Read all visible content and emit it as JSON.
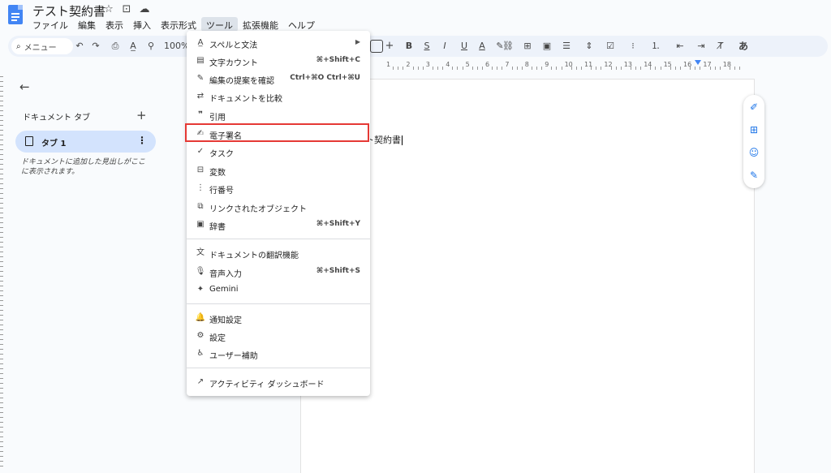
{
  "header": {
    "title": "テスト契約書",
    "menus": [
      "ファイル",
      "編集",
      "表示",
      "挿入",
      "表示形式",
      "ツール",
      "拡張機能",
      "ヘルプ"
    ],
    "active_menu": "ツール"
  },
  "toolbar": {
    "search_label": "メニュー",
    "zoom": "100%",
    "bold": "B",
    "italic": "I",
    "underline": "U",
    "text_color": "A",
    "input_tools": "あ"
  },
  "ruler": {
    "numbers": [
      "1",
      "2",
      "3",
      "4",
      "5",
      "6",
      "7",
      "8",
      "9",
      "10",
      "11",
      "12",
      "13",
      "14",
      "15",
      "16",
      "17",
      "18"
    ]
  },
  "sidebar": {
    "tabs_title": "ドキュメント タブ",
    "tab_label": "タブ 1",
    "hint": "ドキュメントに追加した見出しがここに表示されます。"
  },
  "document": {
    "text": "ト契約書"
  },
  "tools_menu": {
    "items": [
      {
        "label": "スペルと文法",
        "shortcut": "",
        "icon": "spellcheck-icon",
        "submenu": true
      },
      {
        "label": "文字カウント",
        "shortcut": "⌘+Shift+C",
        "icon": "word-count-icon"
      },
      {
        "label": "編集の提案を確認",
        "shortcut": "Ctrl+⌘O Ctrl+⌘U",
        "icon": "review-edits-icon"
      },
      {
        "label": "ドキュメントを比較",
        "shortcut": "",
        "icon": "compare-icon"
      },
      {
        "label": "引用",
        "shortcut": "",
        "icon": "quote-icon"
      },
      {
        "label": "電子署名",
        "shortcut": "",
        "icon": "signature-icon"
      },
      {
        "label": "タスク",
        "shortcut": "",
        "icon": "task-icon"
      },
      {
        "label": "変数",
        "shortcut": "",
        "icon": "variable-icon"
      },
      {
        "label": "行番号",
        "shortcut": "",
        "icon": "line-numbers-icon"
      },
      {
        "label": "リンクされたオブジェクト",
        "shortcut": "",
        "icon": "linked-objects-icon"
      },
      {
        "label": "辞書",
        "shortcut": "⌘+Shift+Y",
        "icon": "dictionary-icon"
      },
      {
        "label": "ドキュメントの翻訳機能",
        "shortcut": "",
        "icon": "translate-icon"
      },
      {
        "label": "音声入力",
        "shortcut": "⌘+Shift+S",
        "icon": "mic-icon"
      },
      {
        "label": "Gemini",
        "shortcut": "",
        "icon": "gemini-icon"
      },
      {
        "label": "通知設定",
        "shortcut": "",
        "icon": "bell-icon"
      },
      {
        "label": "設定",
        "shortcut": "",
        "icon": "settings-icon"
      },
      {
        "label": "ユーザー補助",
        "shortcut": "",
        "icon": "accessibility-icon"
      },
      {
        "label": "アクティビティ ダッシュボード",
        "shortcut": "",
        "icon": "activity-icon"
      }
    ],
    "highlighted": "電子署名",
    "highlight_color": "#e53935"
  },
  "colors": {
    "accent": "#1a73e8",
    "selected_tab": "#d3e3fd",
    "toolbar": "#edf2fa"
  }
}
